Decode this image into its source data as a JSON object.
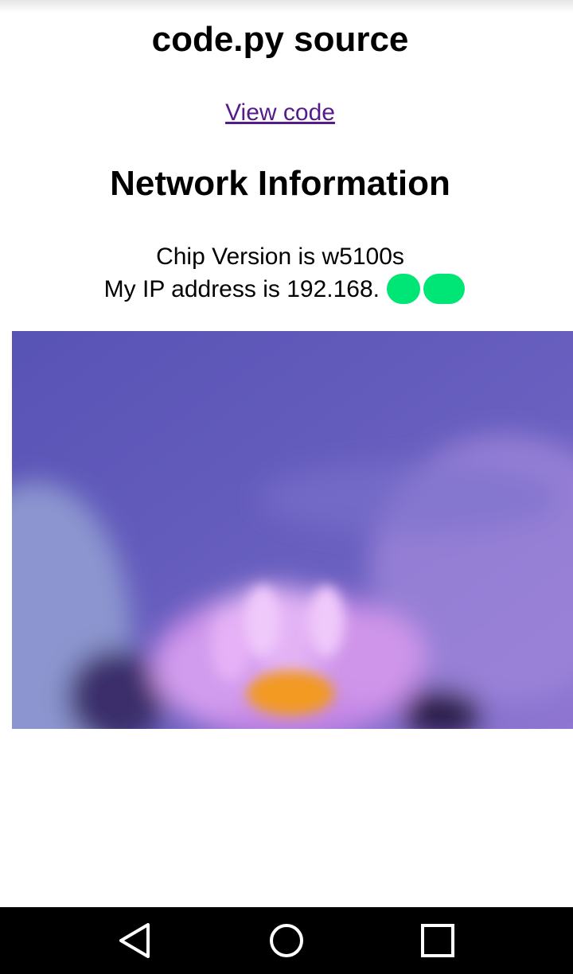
{
  "page": {
    "title": "code.py source",
    "view_link": "View code",
    "section_title": "Network Information",
    "chip_line": "Chip Version is w5100s",
    "ip_line": "My IP address is 192.168.",
    "ip_line_sep": "."
  },
  "image": {
    "icon": "lotus-flower-photo",
    "colors": {
      "sky": "#5d5ab8",
      "petal": "#d59cf0",
      "center": "#f59a2a"
    }
  },
  "colors": {
    "link": "#551a8b",
    "redaction": "#00e676",
    "nav_bar": "#000000"
  },
  "nav": {
    "back_icon": "back-triangle-icon",
    "home_icon": "home-circle-icon",
    "recents_icon": "recents-square-icon"
  }
}
